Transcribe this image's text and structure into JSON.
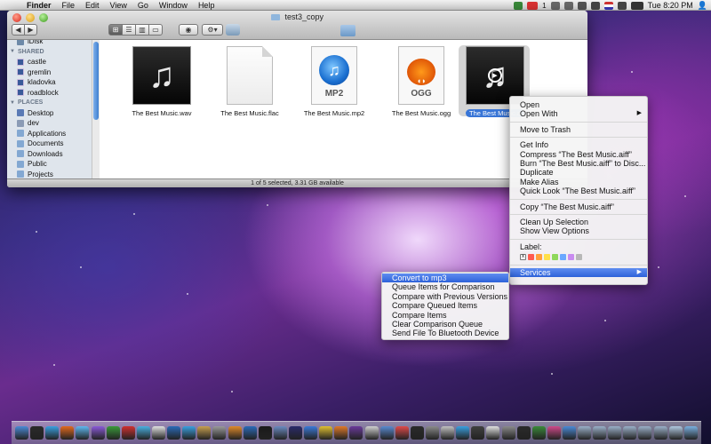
{
  "menubar": {
    "app_name": "Finder",
    "items": [
      "File",
      "Edit",
      "View",
      "Go",
      "Window",
      "Help"
    ],
    "clock": "Tue 8:20 PM",
    "status_icons": [
      "gmail-icon",
      "notification-count-icon",
      "app-icon",
      "timemachine-icon",
      "bluetooth-icon",
      "wifi-icon",
      "flag-icon",
      "volume-icon",
      "battery-icon",
      "user-icon"
    ],
    "notification_count": "1"
  },
  "window": {
    "title": "test3_copy",
    "toolbar": {
      "back": "◀",
      "forward": "▶",
      "view_icon": "⊞",
      "view_list": "☰",
      "view_columns": "▥",
      "view_flow": "▭",
      "quick_look": "◉",
      "action": "⚙▾"
    },
    "status": "1 of 5 selected, 3.31 GB available"
  },
  "sidebar": {
    "top_items": [
      {
        "label": "iDisk",
        "icon": "idisk-icon"
      }
    ],
    "shared_header": "SHARED",
    "shared_items": [
      {
        "label": "castle",
        "icon": "computer-icon"
      },
      {
        "label": "gremlin",
        "icon": "computer-icon"
      },
      {
        "label": "kladovka",
        "icon": "computer-icon"
      },
      {
        "label": "roadblock",
        "icon": "computer-icon"
      }
    ],
    "places_header": "PLACES",
    "places_items": [
      {
        "label": "Desktop",
        "icon": "desktop-icon"
      },
      {
        "label": "dev",
        "icon": "home-icon"
      },
      {
        "label": "Applications",
        "icon": "applications-icon"
      },
      {
        "label": "Documents",
        "icon": "documents-icon"
      },
      {
        "label": "Downloads",
        "icon": "downloads-icon"
      },
      {
        "label": "Public",
        "icon": "folder-icon"
      },
      {
        "label": "Projects",
        "icon": "folder-icon"
      }
    ]
  },
  "files": [
    {
      "name": "The Best Music.wav",
      "kind": "music"
    },
    {
      "name": "The Best Music.flac",
      "kind": "blank"
    },
    {
      "name": "The Best Music.mp2",
      "kind": "mp2",
      "badge": "MP2"
    },
    {
      "name": "The Best Music.ogg",
      "kind": "ogg",
      "badge": "OGG"
    },
    {
      "name": "The Best Music.aiff",
      "kind": "music",
      "selected": true,
      "display_name": "The Best Music.a"
    }
  ],
  "context_menu": {
    "groups": [
      [
        "Open",
        "Open With"
      ],
      [
        "Move to Trash"
      ],
      [
        "Get Info",
        "Compress “The Best Music.aiff”",
        "Burn “The Best Music.aiff” to Disc...",
        "Duplicate",
        "Make Alias",
        "Quick Look “The Best Music.aiff”"
      ],
      [
        "Copy “The Best Music.aiff”"
      ],
      [
        "Clean Up Selection",
        "Show View Options"
      ]
    ],
    "label_title": "Label:",
    "label_colors": [
      "#ff5a50",
      "#ffa03c",
      "#ffe04a",
      "#8fd85a",
      "#6aa8ff",
      "#c98cf0",
      "#b8b8b8"
    ],
    "services": "Services"
  },
  "services_menu": {
    "items": [
      "Convert to mp3",
      "Queue Items for Comparison",
      "Compare with Previous Versions",
      "Compare Queued Items",
      "Compare Items",
      "Clear Comparison Queue",
      "Send File To Bluetooth Device"
    ],
    "highlighted_index": 0
  },
  "dock": {
    "icon_colors": [
      "#4a8ad6",
      "#2a2a2a",
      "#3aa0e0",
      "#e36a1e",
      "#5fb8f0",
      "#8a5ad8",
      "#3a9a3a",
      "#d03030",
      "#4ab0e0",
      "#e0e0e0",
      "#2a6ab8",
      "#3aa0e0",
      "#c8a050",
      "#9a9a9a",
      "#e08a2a",
      "#2a6ab8",
      "#1a1a1a",
      "#6a8ac0",
      "#2a2a6a",
      "#3a7ad8",
      "#e0c030",
      "#e07a2a",
      "#6a3a9a",
      "#d0d0d0",
      "#5a8ad0",
      "#e04a4a",
      "#2a2a2a",
      "#8a8a8a",
      "#c0c0c0",
      "#3aa0e0",
      "#404040",
      "#e0e0e0",
      "#8a8a8a",
      "#2a2a2a",
      "#3a8a3a",
      "#d04a8a",
      "#4a8ad6",
      "#9ab0c8",
      "#9ab0c8",
      "#9ab0c8",
      "#9ab0c8",
      "#9ab0c8",
      "#9ab0c8",
      "#b0c8e0",
      "#7ab0e0"
    ]
  }
}
